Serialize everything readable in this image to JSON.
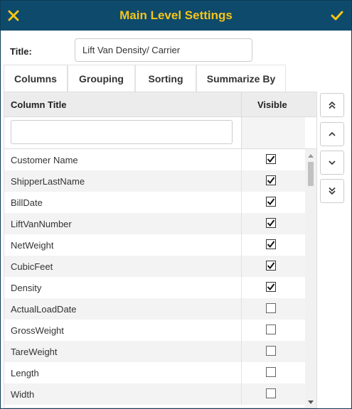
{
  "dialog": {
    "title": "Main Level Settings",
    "accent_color": "#f5c518",
    "header_color": "#0e4a6b"
  },
  "title_field": {
    "label": "Title:",
    "value": "Lift Van Density/ Carrier"
  },
  "tabs": [
    {
      "label": "Columns",
      "active": true
    },
    {
      "label": "Grouping",
      "active": false
    },
    {
      "label": "Sorting",
      "active": false
    },
    {
      "label": "Summarize By",
      "active": false
    }
  ],
  "grid": {
    "headers": {
      "column_title": "Column Title",
      "visible": "Visible"
    },
    "filter_value": "",
    "rows": [
      {
        "name": "Customer Name",
        "visible": true
      },
      {
        "name": "ShipperLastName",
        "visible": true
      },
      {
        "name": "BillDate",
        "visible": true
      },
      {
        "name": "LiftVanNumber",
        "visible": true
      },
      {
        "name": "NetWeight",
        "visible": true
      },
      {
        "name": "CubicFeet",
        "visible": true
      },
      {
        "name": "Density",
        "visible": true
      },
      {
        "name": "ActualLoadDate",
        "visible": false
      },
      {
        "name": "GrossWeight",
        "visible": false
      },
      {
        "name": "TareWeight",
        "visible": false
      },
      {
        "name": "Length",
        "visible": false
      },
      {
        "name": "Width",
        "visible": false
      }
    ]
  },
  "icons": {
    "close": "close-icon",
    "confirm": "check-icon",
    "move_top": "double-chevron-up-icon",
    "move_up": "chevron-up-icon",
    "move_down": "chevron-down-icon",
    "move_bottom": "double-chevron-down-icon"
  }
}
